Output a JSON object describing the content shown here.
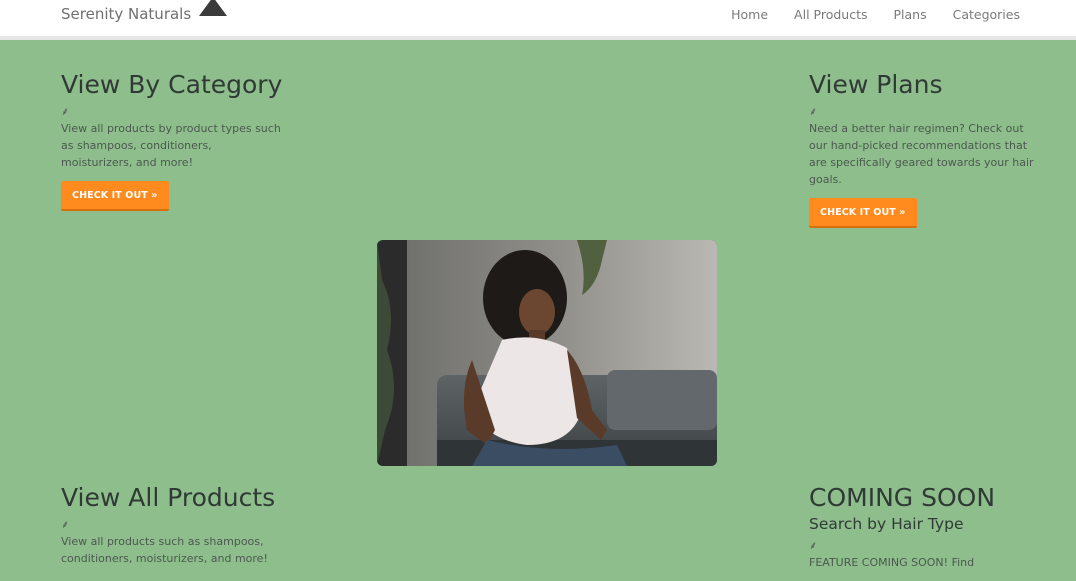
{
  "nav": {
    "brand": "Serenity Naturals",
    "links": [
      "Home",
      "All Products",
      "Plans",
      "Categories"
    ]
  },
  "sections": {
    "category": {
      "title": "View By Category",
      "leaf": "⸙",
      "description": "View all products by product types such as shampoos, conditioners, moisturizers, and more!",
      "button": "CHECK IT OUT »"
    },
    "plans": {
      "title": "View Plans",
      "leaf": "⸙",
      "description": "Need a better hair regimen? Check out our hand-picked recommendations that are specifically geared towards your hair goals.",
      "button": "CHECK IT OUT »"
    },
    "all_products": {
      "title": "View All Products",
      "leaf": "⸙",
      "description": "View all products such as shampoos, conditioners, moisturizers, and more!"
    },
    "coming_soon": {
      "title": "COMING SOON",
      "subtitle": "Search by Hair Type",
      "leaf": "⸙",
      "description": "FEATURE COMING SOON! Find"
    }
  },
  "colors": {
    "background": "#8fbe8d",
    "accent": "#ff8a1d",
    "nav_bg": "#ffffff"
  },
  "icons": {
    "logo": "mountain-logo-icon",
    "leaf": "leaf-divider-icon"
  }
}
